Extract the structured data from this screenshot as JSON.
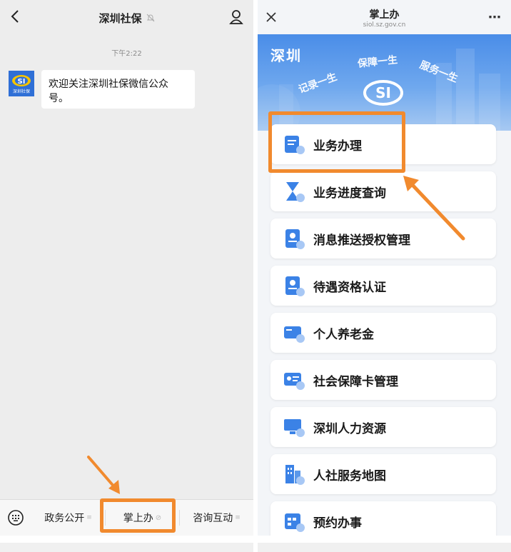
{
  "left": {
    "title": "深圳社保",
    "time": "下午2:22",
    "avatar_label": "深圳社保",
    "message": "欢迎关注深圳社保微信公众号。",
    "menu": [
      "政务公开",
      "掌上办",
      "咨询互动"
    ]
  },
  "right": {
    "title": "掌上办",
    "url": "siol.sz.gov.cn",
    "banner": {
      "city": "深圳",
      "slogans": [
        "记录一生",
        "保障一生",
        "服务一生"
      ]
    },
    "items": [
      "业务办理",
      "业务进度查询",
      "消息推送授权管理",
      "待遇资格认证",
      "个人养老金",
      "社会保障卡管理",
      "深圳人力资源",
      "人社服务地图",
      "预约办事"
    ]
  },
  "colors": {
    "accent": "#f18a2e",
    "brand_blue": "#2f6fd6"
  },
  "icons": [
    "back-icon",
    "mute-bell-icon",
    "profile-icon",
    "keyboard-icon",
    "close-icon",
    "more-icon",
    "link-icon"
  ]
}
